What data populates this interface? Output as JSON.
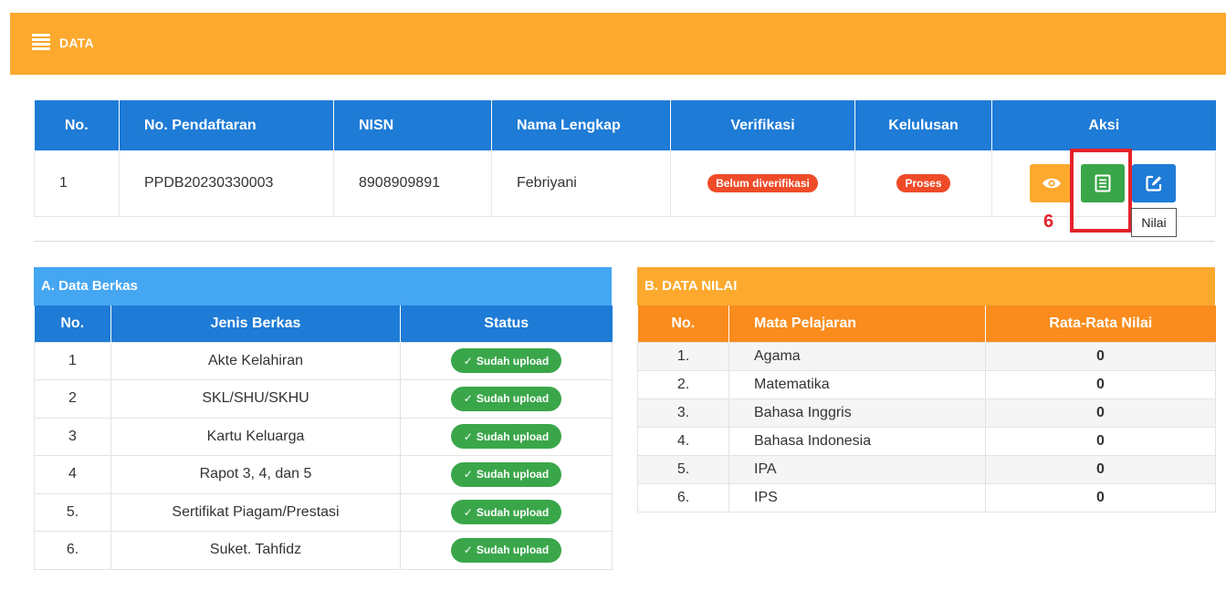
{
  "header": {
    "title": "DATA",
    "icon": "list-icon"
  },
  "main_table": {
    "columns": [
      "No.",
      "No. Pendaftaran",
      "NISN",
      "Nama Lengkap",
      "Verifikasi",
      "Kelulusan",
      "Aksi"
    ],
    "row": {
      "no": "1",
      "no_pendaftaran": "PPDB20230330003",
      "nisn": "8908909891",
      "nama": "Febriyani",
      "verifikasi": "Belum diverifikasi",
      "kelulusan": "Proses"
    }
  },
  "annotation": {
    "step": "6",
    "tooltip": "Nilai"
  },
  "berkas": {
    "title": "A. Data Berkas",
    "columns": [
      "No.",
      "Jenis Berkas",
      "Status"
    ],
    "rows": [
      {
        "no": "1",
        "jenis": "Akte Kelahiran",
        "status": "Sudah upload"
      },
      {
        "no": "2",
        "jenis": "SKL/SHU/SKHU",
        "status": "Sudah upload"
      },
      {
        "no": "3",
        "jenis": "Kartu Keluarga",
        "status": "Sudah upload"
      },
      {
        "no": "4",
        "jenis": "Rapot 3, 4, dan 5",
        "status": "Sudah upload"
      },
      {
        "no": "5.",
        "jenis": "Sertifikat Piagam/Prestasi",
        "status": "Sudah upload"
      },
      {
        "no": "6.",
        "jenis": "Suket. Tahfidz",
        "status": "Sudah upload"
      }
    ]
  },
  "nilai": {
    "title": "B. DATA NILAI",
    "columns": [
      "No.",
      "Mata Pelajaran",
      "Rata-Rata Nilai"
    ],
    "rows": [
      {
        "no": "1.",
        "mapel": "Agama",
        "nilai": "0"
      },
      {
        "no": "2.",
        "mapel": "Matematika",
        "nilai": "0"
      },
      {
        "no": "3.",
        "mapel": "Bahasa Inggris",
        "nilai": "0"
      },
      {
        "no": "4.",
        "mapel": "Bahasa Indonesia",
        "nilai": "0"
      },
      {
        "no": "5.",
        "mapel": "IPA",
        "nilai": "0"
      },
      {
        "no": "6.",
        "mapel": "IPS",
        "nilai": "0"
      }
    ]
  },
  "colors": {
    "orange": "#fca92e",
    "dark_orange": "#f98c1d",
    "blue": "#1e7bd6",
    "light_blue": "#45a6f2",
    "green": "#3aa64a",
    "red": "#ef4b28",
    "highlight_red": "#e4222b"
  }
}
